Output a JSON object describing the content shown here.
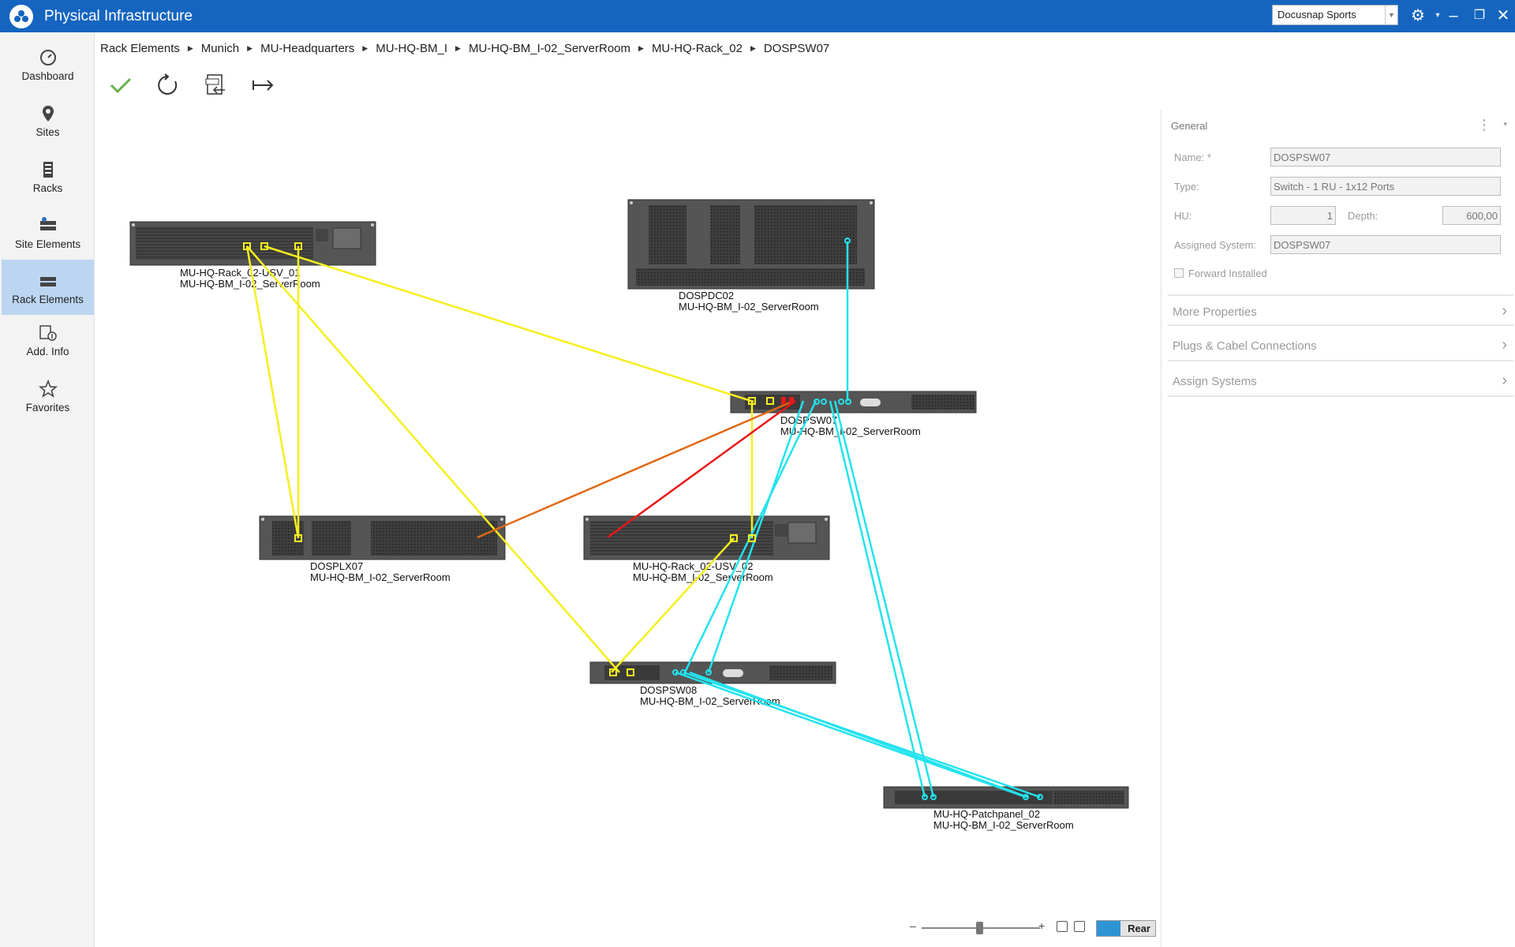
{
  "app": {
    "title": "Physical Infrastructure",
    "tenant": "Docusnap Sports",
    "icons": [
      "logo-icon",
      "settings-icon",
      "minimize-icon",
      "restore-icon",
      "close-icon"
    ]
  },
  "sidebar": {
    "items": [
      {
        "label": "Dashboard",
        "icon": "dashboard-icon",
        "active": false
      },
      {
        "label": "Sites",
        "icon": "location-pin-icon",
        "active": false
      },
      {
        "label": "Racks",
        "icon": "rack-icon",
        "active": false
      },
      {
        "label": "Site Elements",
        "icon": "site-elements-icon",
        "active": false
      },
      {
        "label": "Rack Elements",
        "icon": "rack-elements-icon",
        "active": true
      },
      {
        "label": "Add. Info",
        "icon": "add-info-icon",
        "active": false
      },
      {
        "label": "Favorites",
        "icon": "star-icon",
        "active": false
      }
    ]
  },
  "breadcrumb": [
    "Rack Elements",
    "Munich",
    "MU-Headquarters",
    "MU-HQ-BM_I",
    "MU-HQ-BM_I-02_ServerRoom",
    "MU-HQ-Rack_02",
    "DOSPSW07"
  ],
  "toolbar": {
    "tools": [
      "save-check-icon",
      "refresh-icon",
      "csv-export-icon",
      "collapse-arrow-icon"
    ]
  },
  "diagram": {
    "devices": [
      {
        "name": "MU-HQ-Rack_02-USV_01",
        "location": "MU-HQ-BM_I-02_ServerRoom"
      },
      {
        "name": "DOSPDC02",
        "location": "MU-HQ-BM_I-02_ServerRoom"
      },
      {
        "name": "DOSPSW07",
        "location": "MU-HQ-BM_I-02_ServerRoom"
      },
      {
        "name": "DOSPLX07",
        "location": "MU-HQ-BM_I-02_ServerRoom"
      },
      {
        "name": "MU-HQ-Rack_02-USV_02",
        "location": "MU-HQ-BM_I-02_ServerRoom"
      },
      {
        "name": "DOSPSW08",
        "location": "MU-HQ-BM_I-02_ServerRoom"
      },
      {
        "name": "MU-HQ-Patchpanel_02",
        "location": "MU-HQ-BM_I-02_ServerRoom"
      }
    ],
    "cable_colors": {
      "power": "#f5ef1e",
      "network": "#22e3ee",
      "red": "#e81717",
      "orange": "#e06a14"
    }
  },
  "zoom": {
    "view_label": "Rear"
  },
  "panel": {
    "section": "General",
    "fields": {
      "name_label": "Name: *",
      "name_value": "DOSPSW07",
      "type_label": "Type:",
      "type_value": "Switch - 1 RU - 1x12 Ports",
      "hu_label": "HU:",
      "hu_value": "1",
      "depth_label": "Depth:",
      "depth_value": "600,00",
      "assigned_label": "Assigned System:",
      "assigned_value": "DOSPSW07",
      "forward_label": "Forward Installed"
    },
    "expanders": [
      "More Properties",
      "Plugs & Cabel Connections",
      "Assign Systems"
    ]
  }
}
